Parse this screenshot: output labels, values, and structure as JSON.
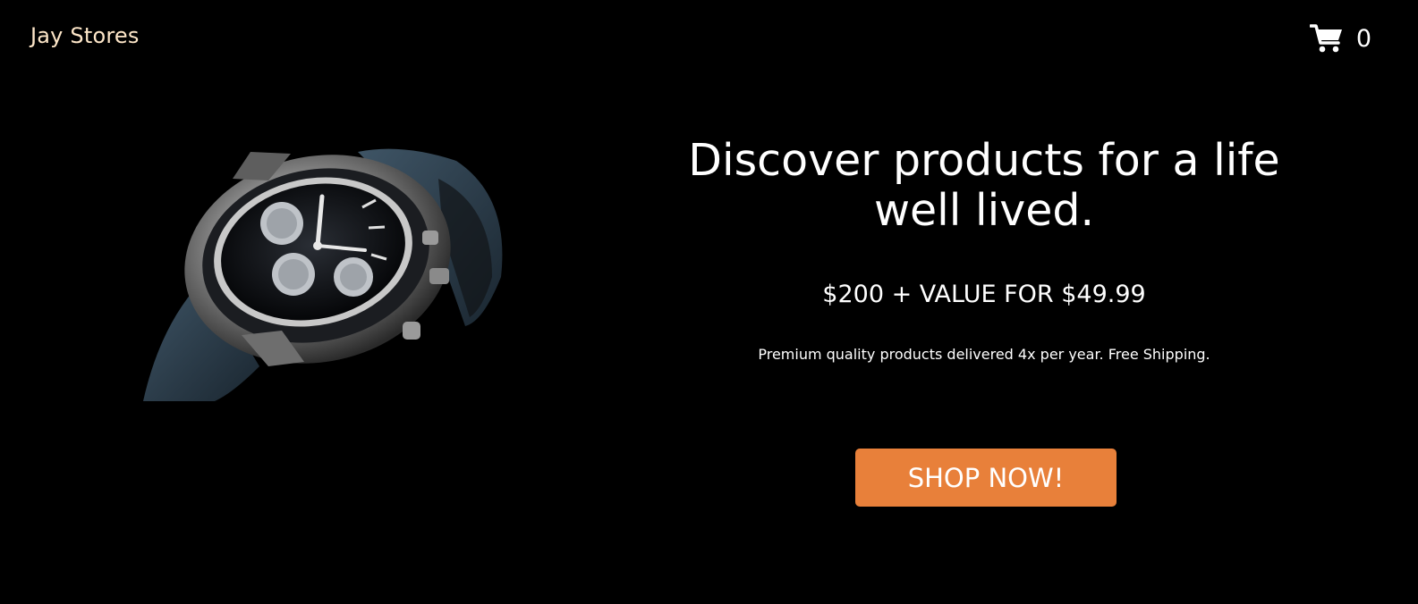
{
  "header": {
    "brand": "Jay Stores",
    "cart_icon": "shopping-cart-icon",
    "cart_count": "0"
  },
  "hero": {
    "image_subject": "chronograph-wristwatch",
    "headline": "Discover products for a life well lived.",
    "offer": "$200 + VALUE FOR $49.99",
    "subtext": "Premium quality products delivered 4x per year. Free Shipping.",
    "cta_label": "SHOP NOW!"
  },
  "colors": {
    "background": "#000000",
    "brand_text": "#fde6c8",
    "accent": "#e8803a",
    "text": "#ffffff"
  }
}
